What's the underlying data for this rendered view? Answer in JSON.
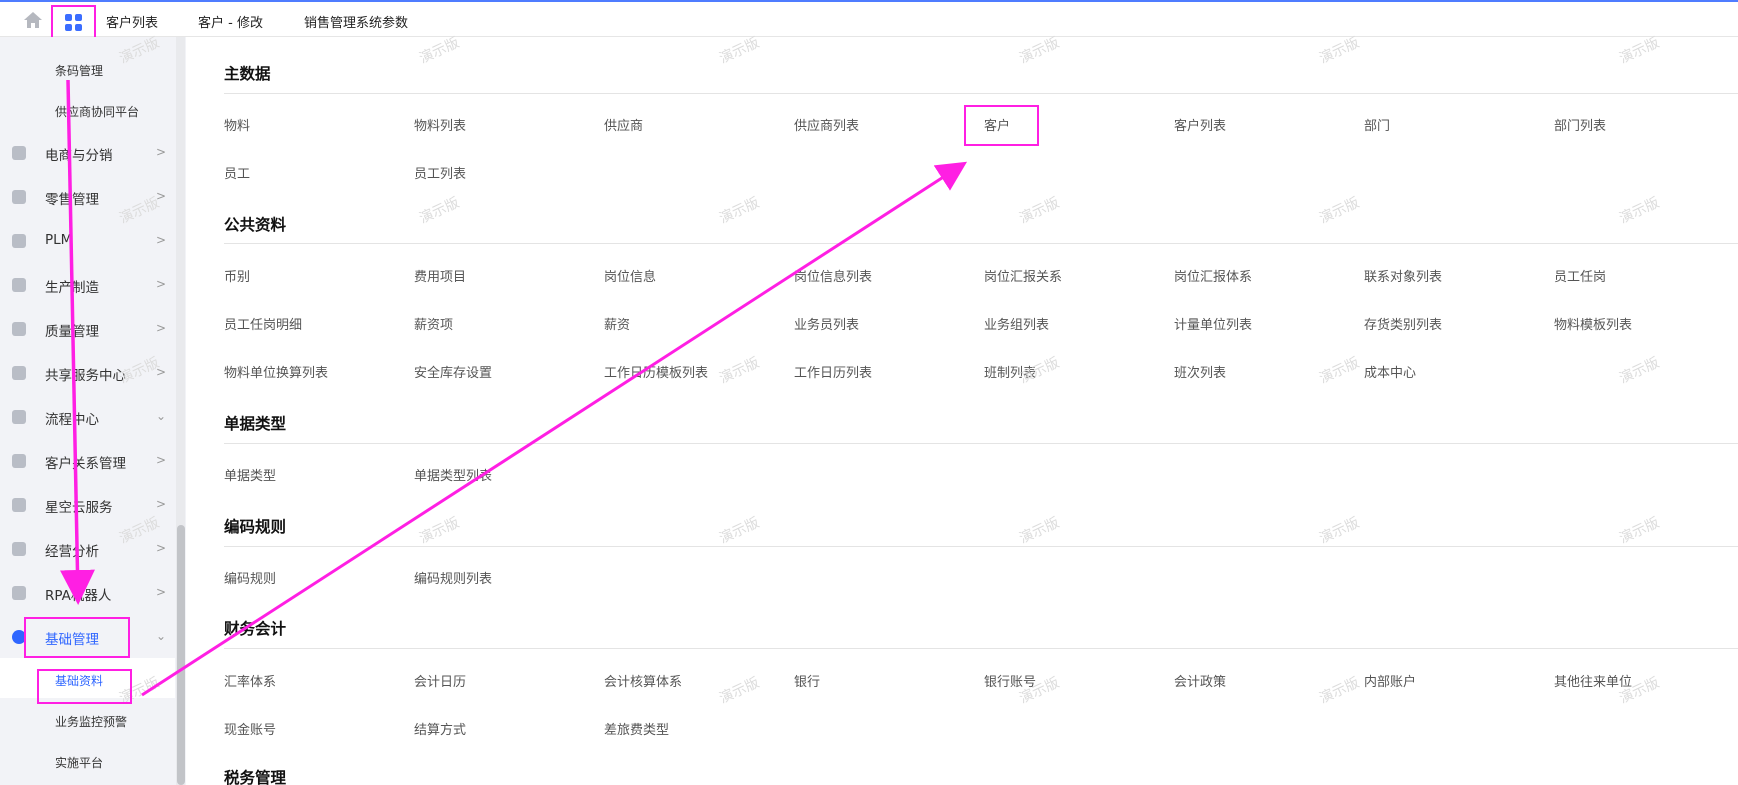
{
  "topbar": {
    "tabs": [
      "客户列表",
      "客户 - 修改",
      "销售管理系统参数"
    ]
  },
  "sidebar": {
    "sub_top": [
      "条码管理",
      "供应商协同平台"
    ],
    "items": [
      {
        "label": "电商与分销",
        "icon": "users-icon"
      },
      {
        "label": "零售管理",
        "icon": "layers-icon"
      },
      {
        "label": "PLM",
        "icon": "plm-icon"
      },
      {
        "label": "生产制造",
        "icon": "factory-icon"
      },
      {
        "label": "质量管理",
        "icon": "shield-icon"
      },
      {
        "label": "共享服务中心",
        "icon": "hexagon-icon"
      },
      {
        "label": "流程中心",
        "icon": "flow-icon"
      },
      {
        "label": "客户关系管理",
        "icon": "contact-icon"
      },
      {
        "label": "星空云服务",
        "icon": "cloud-icon"
      },
      {
        "label": "经营分析",
        "icon": "chart-icon"
      },
      {
        "label": "RPA机器人",
        "icon": "robot-icon"
      },
      {
        "label": "基础管理",
        "icon": "gear-icon"
      }
    ],
    "sub_bottom": [
      "基础资料",
      "业务监控预警",
      "实施平台"
    ]
  },
  "sections": [
    {
      "title": "主数据",
      "items": [
        "物料",
        "物料列表",
        "供应商",
        "供应商列表",
        "客户",
        "客户列表",
        "部门",
        "部门列表",
        "员工",
        "员工列表"
      ]
    },
    {
      "title": "公共资料",
      "items": [
        "币别",
        "费用项目",
        "岗位信息",
        "岗位信息列表",
        "岗位汇报关系",
        "岗位汇报体系",
        "联系对象列表",
        "员工任岗",
        "员工任岗明细",
        "薪资项",
        "薪资",
        "业务员列表",
        "业务组列表",
        "计量单位列表",
        "存货类别列表",
        "物料模板列表",
        "物料单位换算列表",
        "安全库存设置",
        "工作日历模板列表",
        "工作日历列表",
        "班制列表",
        "班次列表",
        "成本中心"
      ]
    },
    {
      "title": "单据类型",
      "items": [
        "单据类型",
        "单据类型列表"
      ]
    },
    {
      "title": "编码规则",
      "items": [
        "编码规则",
        "编码规则列表"
      ]
    },
    {
      "title": "财务会计",
      "items": [
        "汇率体系",
        "会计日历",
        "会计核算体系",
        "银行",
        "银行账号",
        "会计政策",
        "内部账户",
        "其他往来单位",
        "现金账号",
        "结算方式",
        "差旅费类型"
      ]
    },
    {
      "title": "税务管理",
      "items": []
    }
  ],
  "watermark": "演示版",
  "colors": {
    "accent": "#2f66ff",
    "highlight": "#ff1fe3"
  }
}
